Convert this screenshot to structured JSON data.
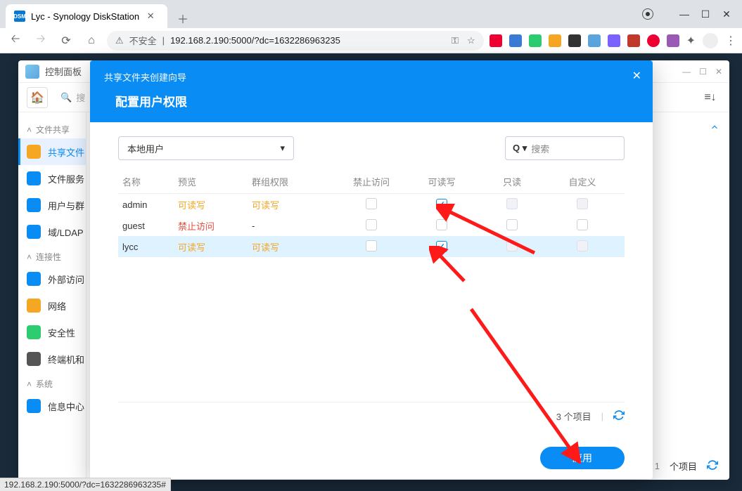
{
  "browser": {
    "tab_title": "Lyc - Synology DiskStation",
    "url_prefix": "不安全",
    "url": "192.168.2.190:5000/?dc=1632286963235",
    "status_url": "192.168.2.190:5000/?dc=1632286963235#"
  },
  "dsm": {
    "window_title": "控制面板",
    "search_placeholder": "搜",
    "footer_count": "个项目",
    "sidebar": {
      "section_fileshare": "文件共享",
      "items_fileshare": [
        {
          "label": "共享文件",
          "icon_bg": "#f5a623"
        },
        {
          "label": "文件服务",
          "icon_bg": "#0a8cf5"
        },
        {
          "label": "用户与群",
          "icon_bg": "#0a8cf5"
        },
        {
          "label": "域/LDAP",
          "icon_bg": "#0a8cf5"
        }
      ],
      "section_connectivity": "连接性",
      "items_connectivity": [
        {
          "label": "外部访问",
          "icon_bg": "#0a8cf5"
        },
        {
          "label": "网络",
          "icon_bg": "#f5a623"
        },
        {
          "label": "安全性",
          "icon_bg": "#2ecc71"
        },
        {
          "label": "终端机和",
          "icon_bg": "#555"
        }
      ],
      "section_system": "系统",
      "items_system": [
        {
          "label": "信息中心",
          "icon_bg": "#0a8cf5"
        }
      ]
    }
  },
  "modal": {
    "title": "共享文件夹创建向导",
    "subtitle": "配置用户权限",
    "dropdown": "本地用户",
    "search_placeholder": "搜索",
    "columns": {
      "name": "名称",
      "preview": "预览",
      "group": "群组权限",
      "deny": "禁止访问",
      "rw": "可读写",
      "ro": "只读",
      "custom": "自定义"
    },
    "rows": [
      {
        "name": "admin",
        "preview": "可读写",
        "preview_class": "preview-rw",
        "group": "可读写",
        "group_class": "preview-rw",
        "deny": false,
        "rw": true,
        "ro_disabled": true,
        "custom_disabled": true
      },
      {
        "name": "guest",
        "preview": "禁止访问",
        "preview_class": "preview-deny",
        "group": "-",
        "group_class": "",
        "deny": false,
        "rw": false,
        "ro_disabled": false,
        "custom_disabled": false
      },
      {
        "name": "lycc",
        "preview": "可读写",
        "preview_class": "preview-rw",
        "group": "可读写",
        "group_class": "preview-rw",
        "deny": false,
        "rw": true,
        "ro_disabled": true,
        "custom_disabled": true,
        "selected": true
      }
    ],
    "item_count_text": "3 个项目",
    "apply": "应用"
  }
}
